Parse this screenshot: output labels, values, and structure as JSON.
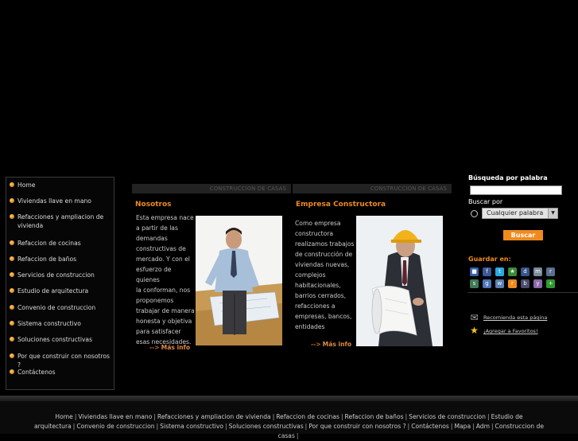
{
  "nav": {
    "items": [
      "Home",
      "Viviendas llave en mano",
      "Refacciones y ampliacion de vivienda",
      "Refaccion de cocinas",
      "Refaccion de baños",
      "Servicios de construccion",
      "Estudio de arquitectura",
      "Convenio de construccion",
      "Sistema constructivo",
      "Soluciones constructivas",
      "Por que construir con nosotros ?",
      "Contáctenos"
    ]
  },
  "col1": {
    "header": "CONSTRUCCION DE CASAS",
    "title": "Nosotros",
    "lines": [
      "Esta empresa nace",
      "a partir de las",
      "demandas",
      "constructivas de",
      "mercado. Y con el",
      "esfuerzo de quienes",
      "la conforman, nos",
      "proponemos",
      "trabajar de manera",
      "honesta y objetiva",
      "para satisfacer",
      "esas necesidades."
    ],
    "more": "Más info",
    "arrow": "-->"
  },
  "col2": {
    "header": "CONSTRUCCION DE CASAS",
    "title": "Empresa Constructora",
    "lines": [
      "Como empresa",
      "constructora",
      "realizamos trabajos",
      "de construcción de",
      "viviendas nuevas,",
      "complejos",
      "habitacionales,",
      "barrios cerrados,",
      "refacciones a",
      "empresas, bancos,",
      "entidades"
    ],
    "more": "Más info",
    "arrow": "-->"
  },
  "sidebar": {
    "search_label": "Búsqueda por palabra",
    "search_value": "",
    "buscar_por": "Buscar por",
    "select_value": "Cualquier palabra",
    "button": "Buscar",
    "guardar": "Guardar en:",
    "recomienda": "Recomienda esta página",
    "favoritos": "¡Agregar a Favoritos!"
  },
  "footer": {
    "links": [
      "Home",
      "Viviendas llave en mano",
      "Refacciones y ampliacion de vivienda",
      "Refaccion de cocinas",
      "Refaccion de baños",
      "Servicios de construccion",
      "Estudio de arquitectura",
      "Convenio de construccion",
      "Sistema constructivo",
      "Soluciones constructivas",
      "Por que construir con nosotros ?",
      "Contáctenos",
      "Mapa",
      "Adm",
      "Construccion de casas"
    ]
  },
  "colors": {
    "accent": "#f08a1d",
    "background": "#000000"
  }
}
